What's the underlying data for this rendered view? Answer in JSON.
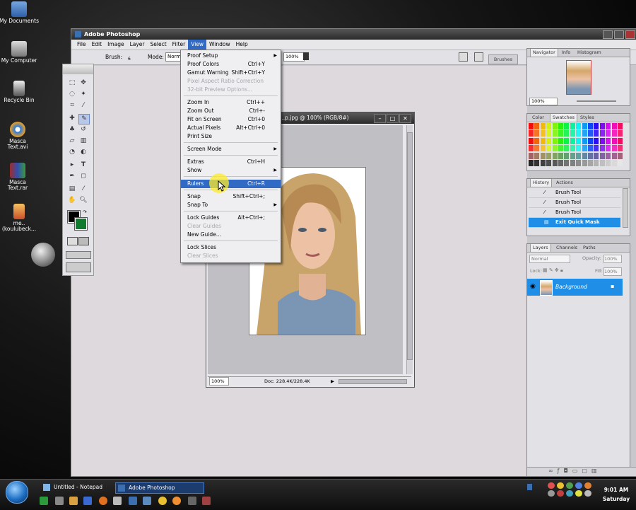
{
  "desktop": {
    "icons": [
      {
        "label": "My Documents"
      },
      {
        "label": "My Computer"
      },
      {
        "label": "Recycle Bin"
      },
      {
        "label": "Masca Text.avi"
      },
      {
        "label": "Masca Text.rar"
      },
      {
        "label": "me.. (koulubeck..."
      }
    ]
  },
  "app": {
    "title": "Adobe Photoshop",
    "menus": [
      "File",
      "Edit",
      "Image",
      "Layer",
      "Select",
      "Filter",
      "View",
      "Window",
      "Help"
    ],
    "active_menu": "View",
    "options": {
      "brush_label": "Brush:",
      "brush_size": "6",
      "mode_label": "Mode:",
      "mode_value": "Norm",
      "zoom_value": "100%"
    },
    "palette_well_tab": "Brushes"
  },
  "view_menu": {
    "items": [
      {
        "label": "Proof Setup",
        "shortcut": "",
        "submenu": true,
        "disabled": false
      },
      {
        "label": "Proof Colors",
        "shortcut": "Ctrl+Y",
        "submenu": false,
        "disabled": false
      },
      {
        "label": "Gamut Warning",
        "shortcut": "Shift+Ctrl+Y",
        "submenu": false,
        "disabled": false
      },
      {
        "label": "Pixel Aspect Ratio Correction",
        "shortcut": "",
        "submenu": false,
        "disabled": true
      },
      {
        "label": "32-bit Preview Options...",
        "shortcut": "",
        "submenu": false,
        "disabled": true
      },
      {
        "label": "Zoom In",
        "shortcut": "Ctrl++",
        "submenu": false,
        "disabled": false
      },
      {
        "label": "Zoom Out",
        "shortcut": "Ctrl+-",
        "submenu": false,
        "disabled": false
      },
      {
        "label": "Fit on Screen",
        "shortcut": "Ctrl+0",
        "submenu": false,
        "disabled": false
      },
      {
        "label": "Actual Pixels",
        "shortcut": "Alt+Ctrl+0",
        "submenu": false,
        "disabled": false
      },
      {
        "label": "Print Size",
        "shortcut": "",
        "submenu": false,
        "disabled": false
      },
      {
        "label": "Screen Mode",
        "shortcut": "",
        "submenu": true,
        "disabled": false
      },
      {
        "label": "Extras",
        "shortcut": "Ctrl+H",
        "submenu": false,
        "disabled": false
      },
      {
        "label": "Show",
        "shortcut": "",
        "submenu": true,
        "disabled": false
      },
      {
        "label": "Rulers",
        "shortcut": "Ctrl+R",
        "submenu": false,
        "disabled": false,
        "highlighted": true
      },
      {
        "label": "Snap",
        "shortcut": "Shift+Ctrl+;",
        "submenu": false,
        "disabled": false
      },
      {
        "label": "Snap To",
        "shortcut": "",
        "submenu": true,
        "disabled": false
      },
      {
        "label": "Lock Guides",
        "shortcut": "Alt+Ctrl+;",
        "submenu": false,
        "disabled": false
      },
      {
        "label": "Clear Guides",
        "shortcut": "",
        "submenu": false,
        "disabled": true
      },
      {
        "label": "New Guide...",
        "shortcut": "",
        "submenu": false,
        "disabled": false
      },
      {
        "label": "Lock Slices",
        "shortcut": "",
        "submenu": false,
        "disabled": false
      },
      {
        "label": "Clear Slices",
        "shortcut": "",
        "submenu": false,
        "disabled": true
      }
    ]
  },
  "document": {
    "title": "...p.jpg @ 100% (RGB/8#)",
    "zoom": "100%",
    "doc_size": "Doc: 228.4K/228.4K"
  },
  "navigator": {
    "tabs": [
      "Navigator",
      "Info",
      "Histogram"
    ],
    "zoom": "100%"
  },
  "color_palette": {
    "tabs": [
      "Color",
      "Swatches",
      "Styles"
    ]
  },
  "history": {
    "tabs": [
      "History",
      "Actions"
    ],
    "items": [
      "Brush Tool",
      "Brush Tool",
      "Brush Tool",
      "Exit Quick Mask"
    ],
    "selected_index": 3
  },
  "layers": {
    "tabs": [
      "Layers",
      "Channels",
      "Paths"
    ],
    "blend_mode": "Normal",
    "opacity_label": "Opacity:",
    "opacity_value": "100%",
    "lock_label": "Lock:",
    "fill_label": "Fill:",
    "fill_value": "100%",
    "layer_name": "Background"
  },
  "taskbar": {
    "buttons": [
      "Untitled - Notepad",
      "Adobe Photoshop"
    ],
    "active": "Adobe Photoshop",
    "time": "9:01 AM",
    "day": "Saturday"
  },
  "colors": {
    "selection": "#316ac5",
    "layer_selected": "#1e8ee6",
    "foreground": "#000000",
    "background": "#107a2e"
  }
}
